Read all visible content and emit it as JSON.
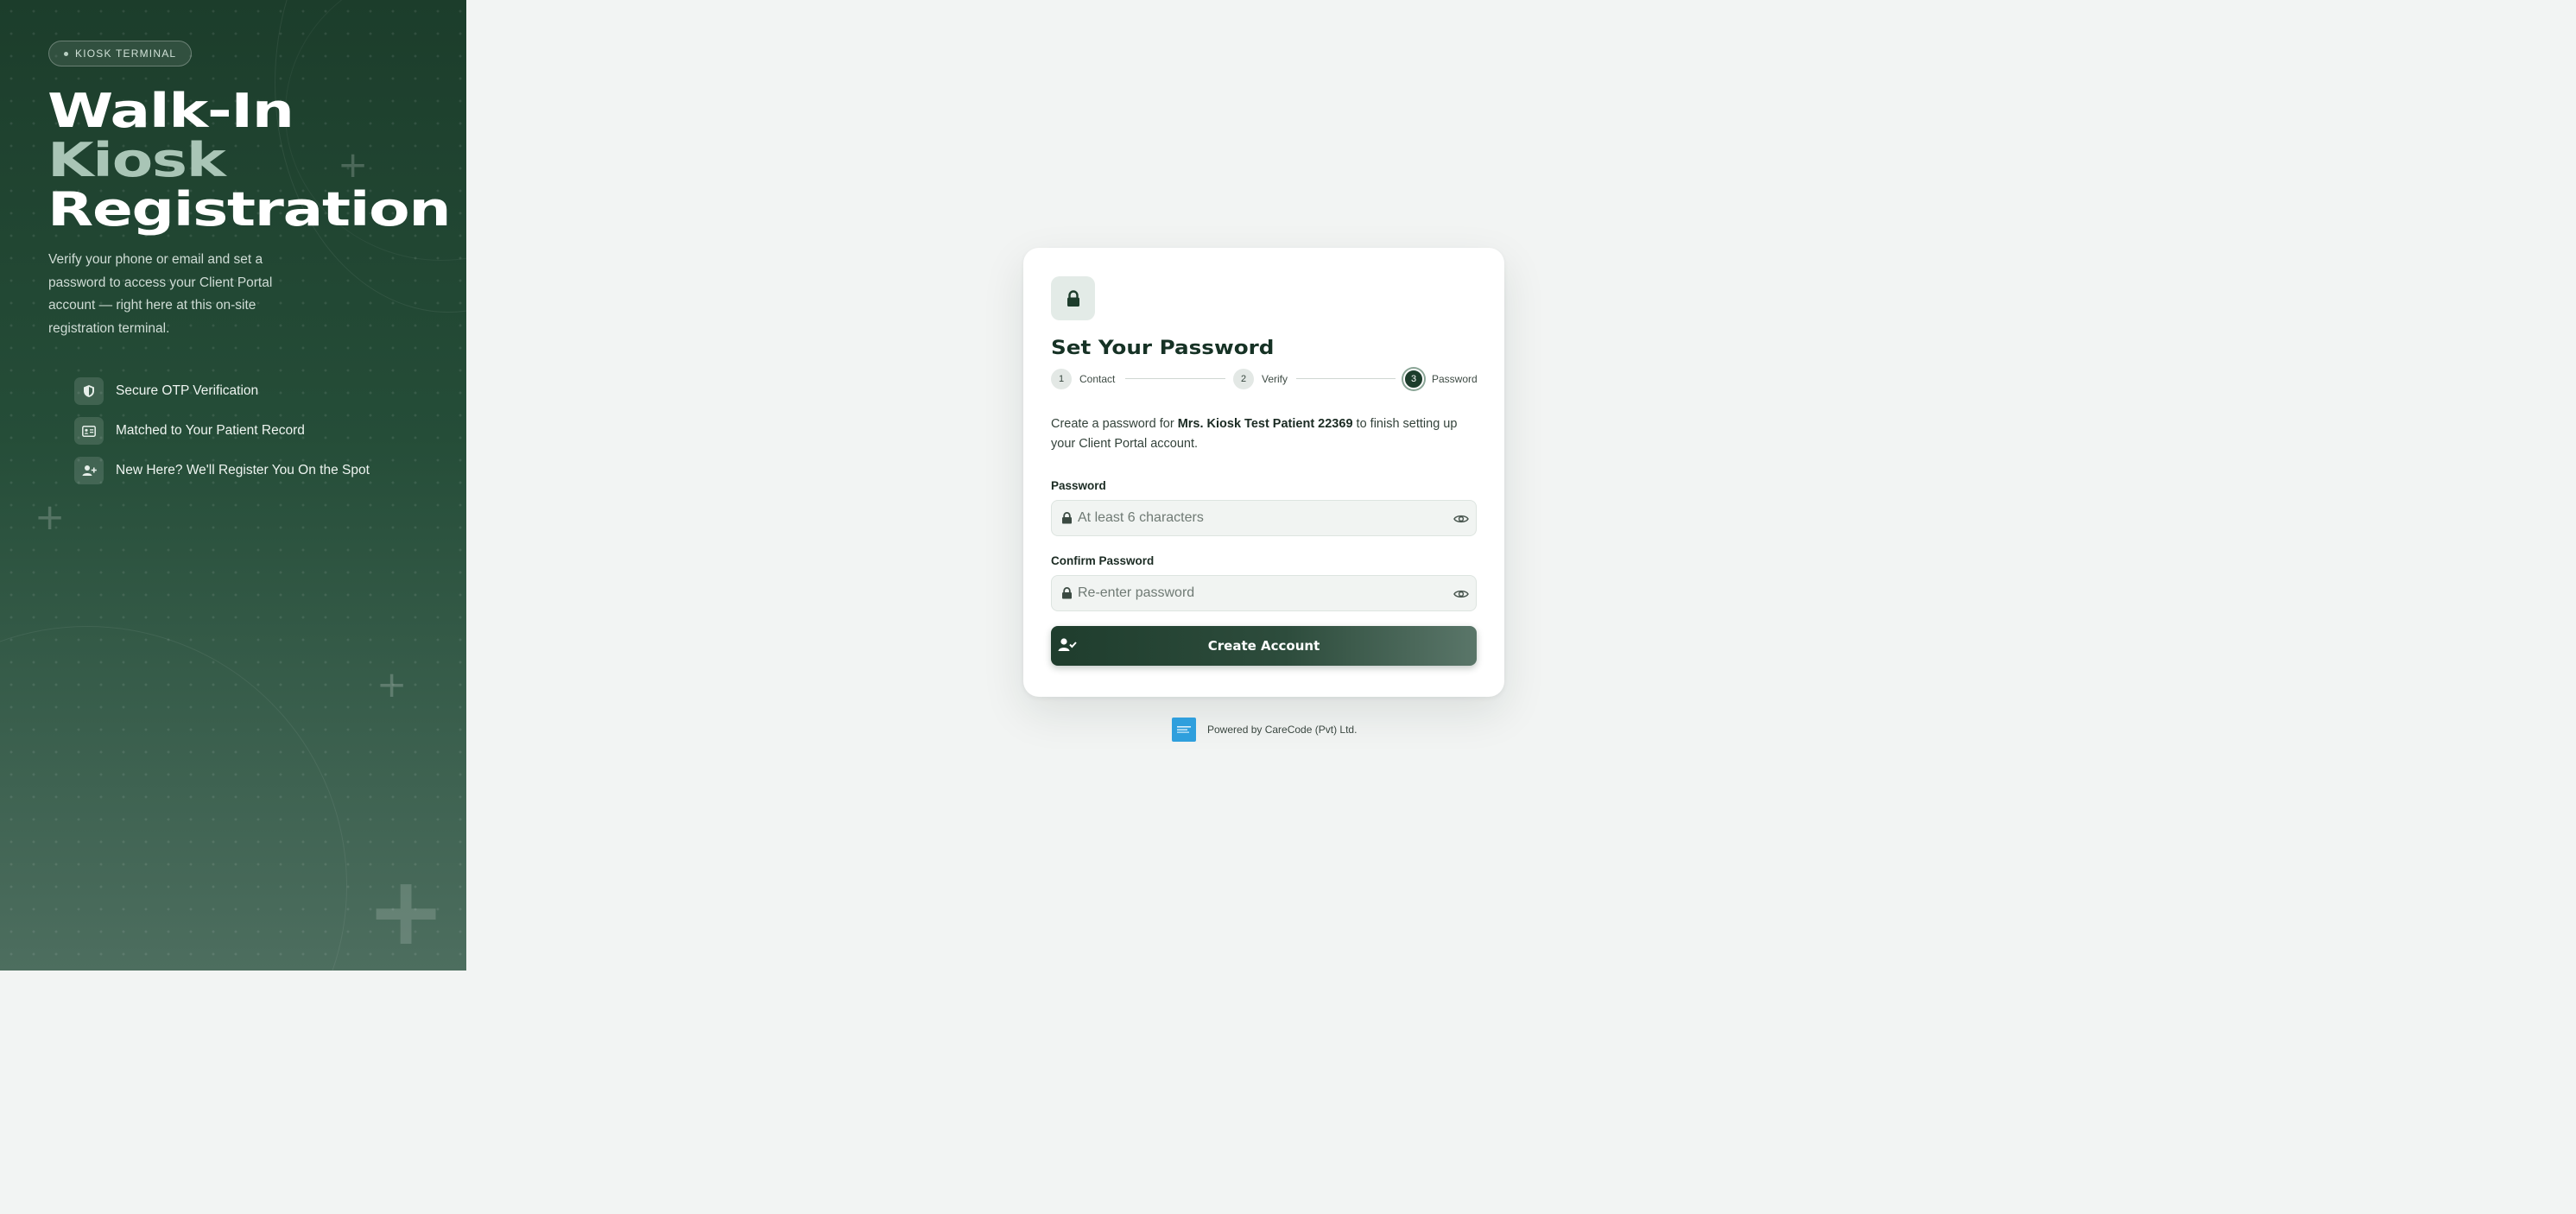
{
  "hero": {
    "badge": "KIOSK TERMINAL",
    "title_line1": "Walk-In",
    "title_line2": "Kiosk",
    "title_line3": "Registration",
    "subtitle": "Verify your phone or email and set a password to access your Client Portal account — right here at this on-site registration terminal.",
    "features": [
      {
        "icon": "shield-icon",
        "label": "Secure OTP Verification"
      },
      {
        "icon": "id-card-icon",
        "label": "Matched to Your Patient Record"
      },
      {
        "icon": "user-plus-icon",
        "label": "New Here? We'll Register You On the Spot"
      }
    ]
  },
  "card": {
    "icon": "lock-icon",
    "title": "Set Your Password",
    "steps": [
      {
        "number": "1",
        "label": "Contact"
      },
      {
        "number": "2",
        "label": "Verify"
      },
      {
        "number": "3",
        "label": "Password"
      }
    ],
    "active_step": 3,
    "intro_prefix": "Create a password for ",
    "patient_name": "Mrs. Kiosk Test Patient 22369",
    "intro_suffix": " to finish setting up your Client Portal account.",
    "password_label": "Password",
    "password_placeholder": "At least 6 characters",
    "password_value": "",
    "confirm_label": "Confirm Password",
    "confirm_placeholder": "Re-enter password",
    "confirm_value": "",
    "submit_label": "Create Account"
  },
  "footer": {
    "powered_by": "Powered by CareCode (Pvt) Ltd."
  },
  "colors": {
    "brand_dark": "#1d3d2c",
    "page_bg": "#f2f4f3",
    "logo_blue": "#2f9fdd"
  }
}
